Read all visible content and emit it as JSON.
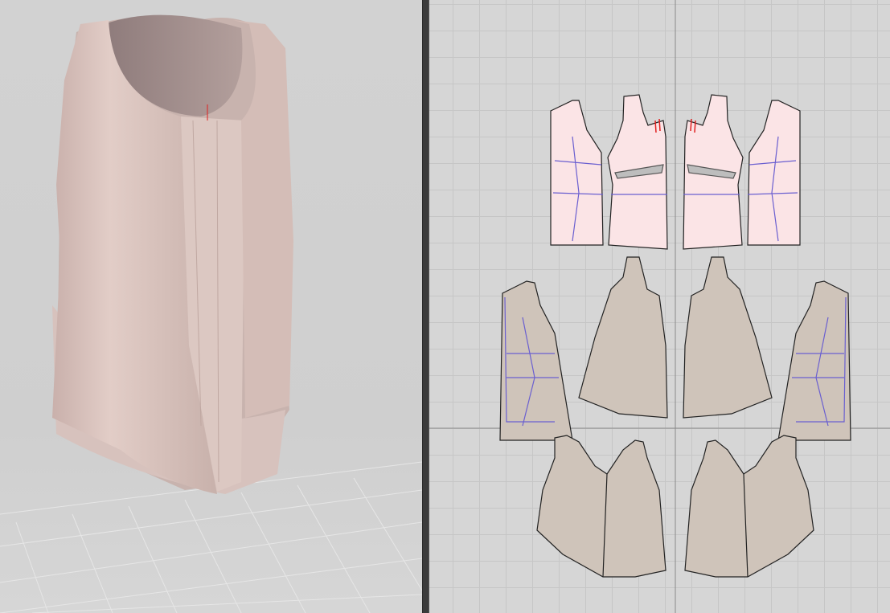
{
  "colors": {
    "view3d_background": "#d0d0d0",
    "view2d_background": "#d6d6d6",
    "divider": "#3b3b3b",
    "fabric_pink": "#fbe4e6",
    "fabric_tan": "#cfc4ba",
    "garment": "#d9c3bd",
    "outline": "#222222",
    "internal_line": "#6a5fd0",
    "notch_mark": "#e02020"
  }
}
